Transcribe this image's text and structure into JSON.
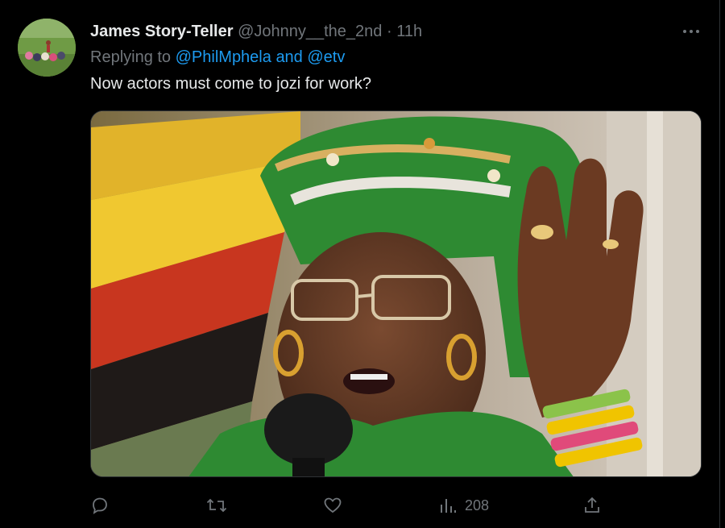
{
  "tweet": {
    "display_name": "James Story-Teller",
    "handle": "@Johnny__the_2nd",
    "separator": "·",
    "time": "11h",
    "replying_prefix": "Replying to",
    "replying_mention_1": "@PhilMphela",
    "replying_and": "and",
    "replying_mention_2": "@etv",
    "text": "Now actors must come to jozi for work?",
    "avatar_icon": "avatar-photo",
    "media_icon": "tweet-photo"
  },
  "actions": {
    "reply_icon": "reply-icon",
    "retweet_icon": "retweet-icon",
    "like_icon": "like-icon",
    "views_icon": "views-icon",
    "views_count": "208",
    "share_icon": "share-icon"
  },
  "colors": {
    "background": "#000000",
    "text": "#e7e9ea",
    "muted": "#71767b",
    "link": "#1d9bf0",
    "border": "#2f3336"
  }
}
